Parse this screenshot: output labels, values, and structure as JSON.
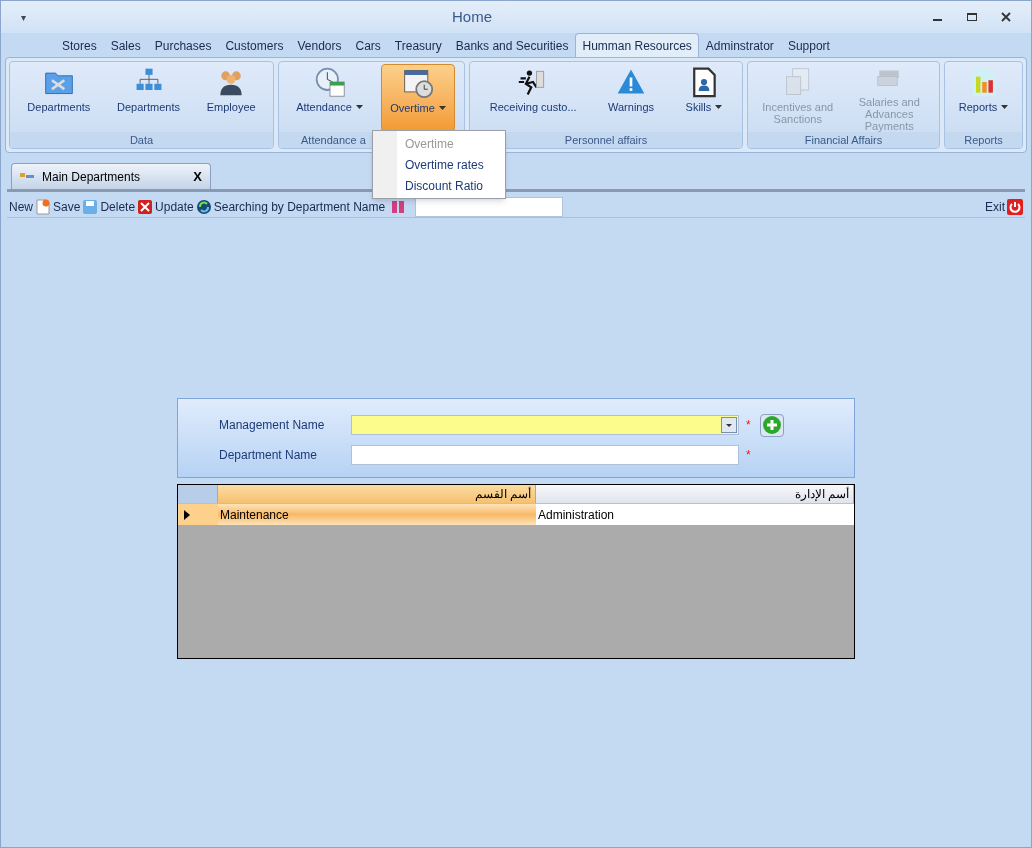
{
  "window": {
    "title": "Home",
    "quick_access": "▾"
  },
  "menu_tabs": [
    {
      "label": "Stores",
      "selected": false
    },
    {
      "label": "Sales",
      "selected": false
    },
    {
      "label": "Purchases",
      "selected": false
    },
    {
      "label": "Customers",
      "selected": false
    },
    {
      "label": "Vendors",
      "selected": false
    },
    {
      "label": "Cars",
      "selected": false
    },
    {
      "label": "Treasury",
      "selected": false
    },
    {
      "label": "Banks and Securities",
      "selected": false
    },
    {
      "label": "Humman Resources",
      "selected": true
    },
    {
      "label": "Adminstrator",
      "selected": false
    },
    {
      "label": "Support",
      "selected": false
    }
  ],
  "ribbon_groups": [
    {
      "label": "Data",
      "buttons": [
        {
          "label": "Departments",
          "kind": "folder",
          "dropdown": false,
          "disabled": false,
          "selected": false
        },
        {
          "label": "Departments",
          "kind": "org",
          "dropdown": false,
          "disabled": false,
          "selected": false
        },
        {
          "label": "Employee",
          "kind": "people",
          "dropdown": false,
          "disabled": false,
          "selected": false
        }
      ]
    },
    {
      "label": "Attendance a",
      "buttons": [
        {
          "label": "Attendance",
          "kind": "clock",
          "dropdown": true,
          "disabled": false,
          "selected": false
        },
        {
          "label": "Overtime",
          "kind": "calendar",
          "dropdown": true,
          "disabled": false,
          "selected": true
        }
      ]
    },
    {
      "label": "Personnel affairs",
      "buttons": [
        {
          "label": "Receiving custo...",
          "kind": "runner",
          "dropdown": false,
          "disabled": false,
          "selected": false
        },
        {
          "label": "Warnings",
          "kind": "warning",
          "dropdown": false,
          "disabled": false,
          "selected": false
        },
        {
          "label": "Skills",
          "kind": "badge",
          "dropdown": true,
          "disabled": false,
          "selected": false
        }
      ]
    },
    {
      "label": "Financial Affairs",
      "buttons": [
        {
          "label": "Incentives and Sanctions",
          "kind": "papers",
          "dropdown": false,
          "disabled": true,
          "selected": false
        },
        {
          "label": "Salaries and Advances Payments",
          "kind": "money",
          "dropdown": false,
          "disabled": true,
          "selected": false
        }
      ]
    },
    {
      "label": "Reports",
      "buttons": [
        {
          "label": "Reports",
          "kind": "chart",
          "dropdown": true,
          "disabled": false,
          "selected": false
        }
      ]
    }
  ],
  "dropdown_menu": [
    {
      "label": "Overtime",
      "disabled": true
    },
    {
      "label": "Overtime rates",
      "disabled": false
    },
    {
      "label": "Discount Ratio",
      "disabled": false
    }
  ],
  "document_tab": {
    "label": "Main Departments",
    "close": "X"
  },
  "toolbar": {
    "items": [
      {
        "label": "New",
        "kind": "plain"
      },
      {
        "label": "Save",
        "kind": "new"
      },
      {
        "label": "Delete",
        "kind": "save"
      },
      {
        "label": "Update",
        "kind": "delete"
      },
      {
        "label": "Searching by Department Name",
        "kind": "update"
      }
    ],
    "exit": "Exit"
  },
  "form": {
    "fields": [
      {
        "label": "Management Name",
        "kind": "combo",
        "required": true,
        "add_button": true
      },
      {
        "label": "Department Name",
        "kind": "text",
        "required": true,
        "add_button": false
      }
    ],
    "required_mark": "*"
  },
  "grid": {
    "columns": [
      {
        "label": "أسم القسم",
        "selected": true
      },
      {
        "label": "أسم الإدارة",
        "selected": false
      }
    ],
    "rows": [
      {
        "cells": [
          "Maintenance",
          "Administration"
        ],
        "selected": true
      }
    ]
  }
}
